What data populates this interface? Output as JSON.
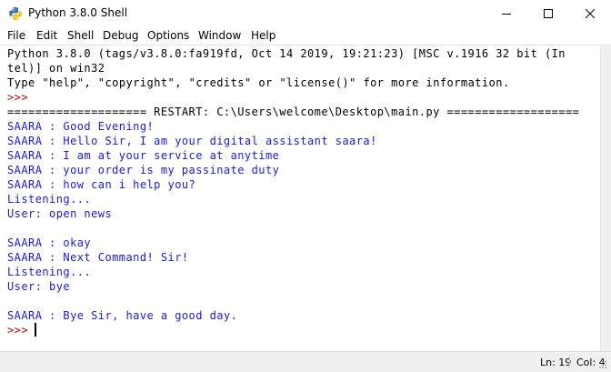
{
  "window": {
    "title": "Python 3.8.0 Shell",
    "icon": "python-icon",
    "controls": [
      "minimize-icon",
      "maximize-icon",
      "close-icon"
    ]
  },
  "menu": [
    "File",
    "Edit",
    "Shell",
    "Debug",
    "Options",
    "Window",
    "Help"
  ],
  "shell": {
    "lines": [
      {
        "text": "Python 3.8.0 (tags/v3.8.0:fa919fd, Oct 14 2019, 19:21:23) [MSC v.1916 32 bit (In",
        "color": "black"
      },
      {
        "text": "tel)] on win32",
        "color": "black"
      },
      {
        "text": "Type \"help\", \"copyright\", \"credits\" or \"license()\" for more information.",
        "color": "black"
      },
      {
        "text": ">>> ",
        "color": "red"
      },
      {
        "text": "==================== RESTART: C:\\Users\\welcome\\Desktop\\main.py ===================",
        "color": "black"
      },
      {
        "text": "SAARA : Good Evening!",
        "color": "blue"
      },
      {
        "text": "SAARA : Hello Sir, I am your digital assistant saara!",
        "color": "blue"
      },
      {
        "text": "SAARA : I am at your service at anytime",
        "color": "blue"
      },
      {
        "text": "SAARA : your order is my passinate duty",
        "color": "blue"
      },
      {
        "text": "SAARA : how can i help you?",
        "color": "blue"
      },
      {
        "text": "Listening...",
        "color": "blue"
      },
      {
        "text": "User: open news",
        "color": "blue"
      },
      {
        "text": "",
        "color": "blue"
      },
      {
        "text": "SAARA : okay",
        "color": "blue"
      },
      {
        "text": "SAARA : Next Command! Sir!",
        "color": "blue"
      },
      {
        "text": "Listening...",
        "color": "blue"
      },
      {
        "text": "User: bye",
        "color": "blue"
      },
      {
        "text": "",
        "color": "blue"
      },
      {
        "text": "SAARA : Bye Sir, have a good day.",
        "color": "blue"
      },
      {
        "text": ">>> ",
        "color": "red"
      }
    ]
  },
  "status": {
    "line": "Ln: 19",
    "col": "Col: 4"
  },
  "colors": {
    "black": "#000000",
    "blue": "#1b1bd8",
    "red": "#c00000",
    "purple": "#7a00a0"
  }
}
